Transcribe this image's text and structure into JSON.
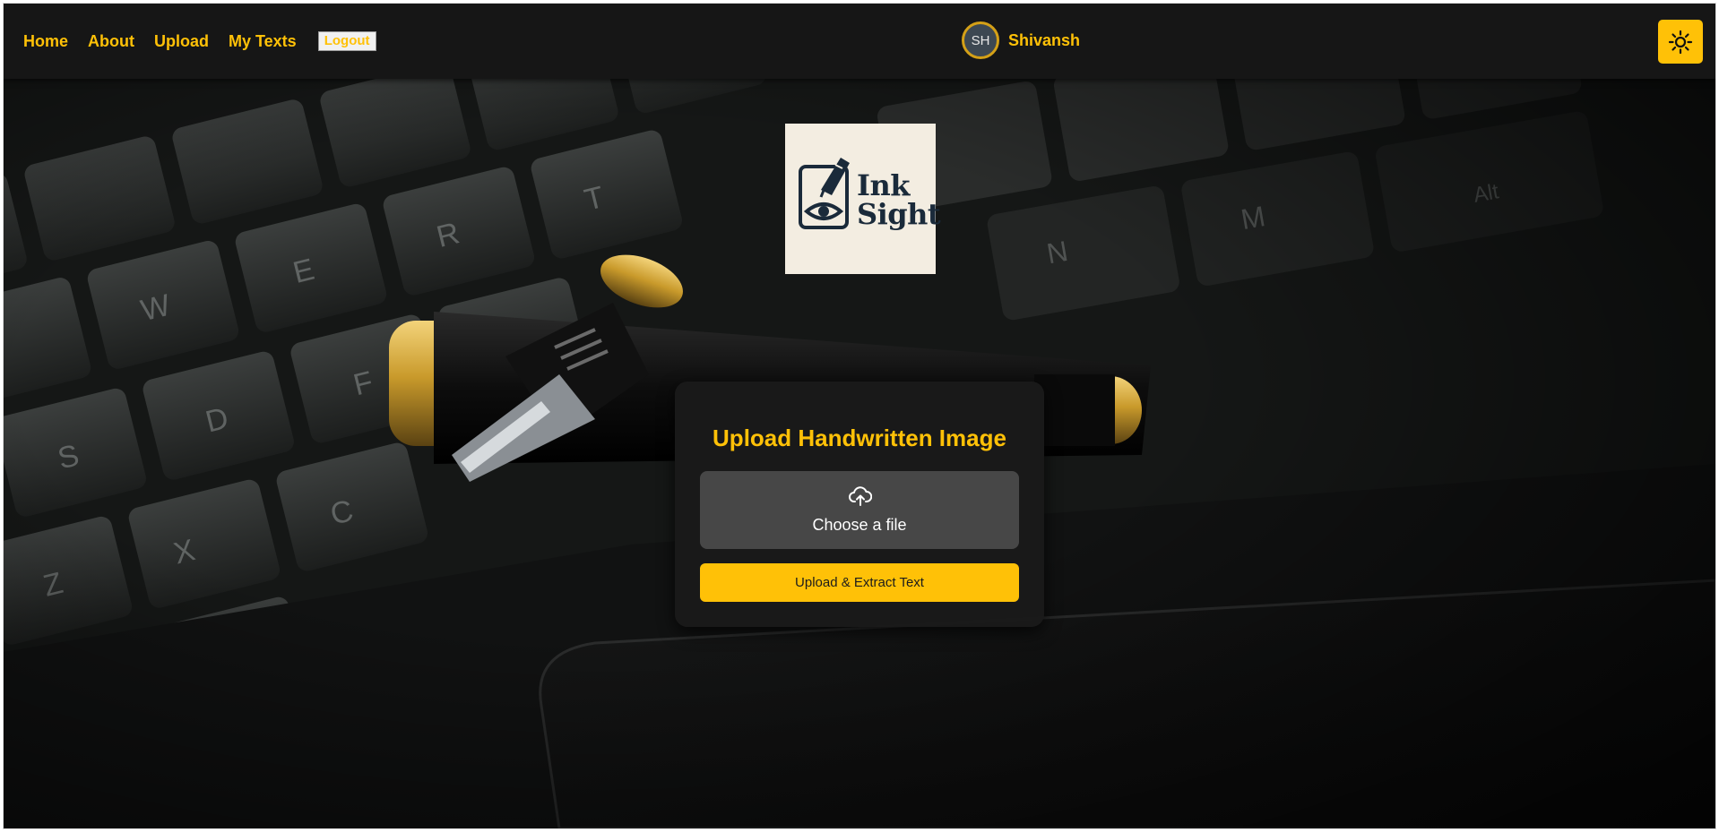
{
  "nav": {
    "links": [
      "Home",
      "About",
      "Upload",
      "My Texts"
    ],
    "logout_label": "Logout"
  },
  "user": {
    "initials": "SH",
    "name": "Shivansh"
  },
  "theme_toggle": {
    "icon": "sun-icon"
  },
  "logo": {
    "line1": "Ink",
    "line2": "Sight",
    "icon": "pen-eye-icon"
  },
  "upload": {
    "title": "Upload Handwritten Image",
    "file_label": "Choose a file",
    "file_icon": "cloud-upload-icon",
    "submit_label": "Upload & Extract Text"
  },
  "colors": {
    "accent": "#ffc107",
    "navbar": "#161616",
    "card": "#1a1a1a",
    "file_picker": "#474747"
  }
}
